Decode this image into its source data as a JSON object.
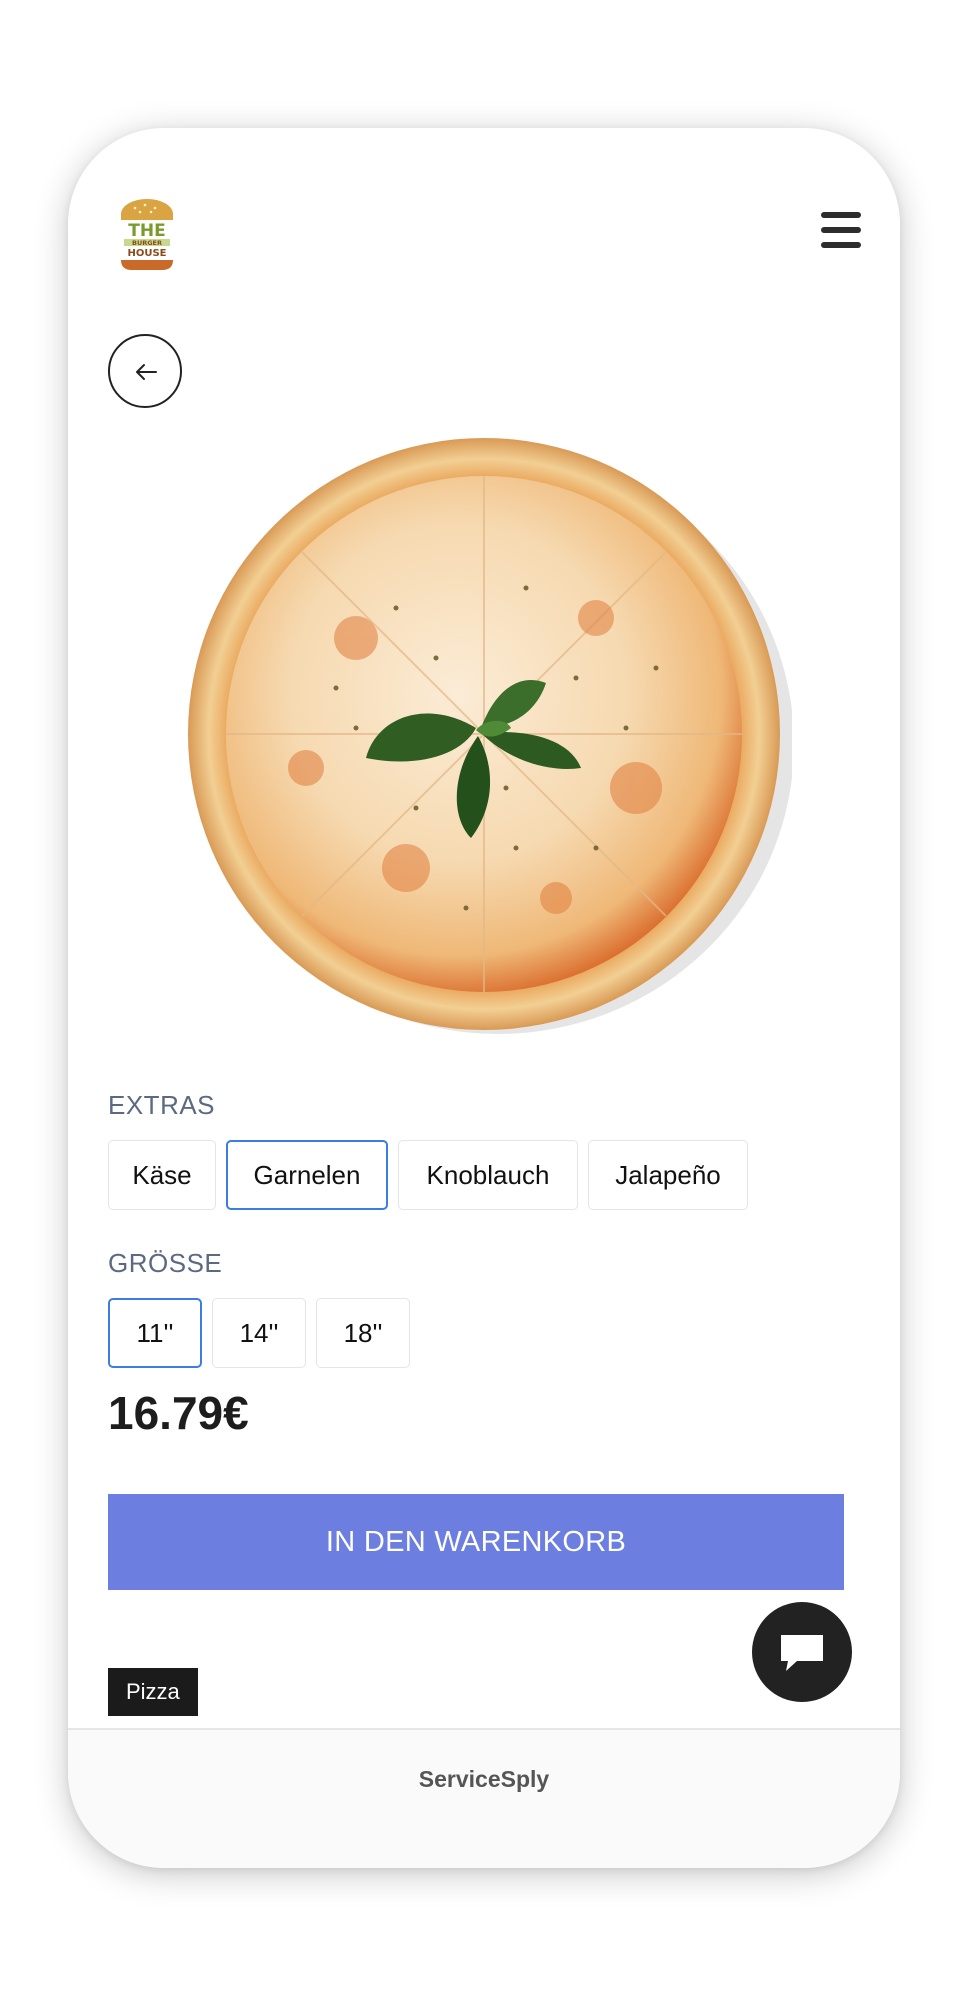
{
  "header": {
    "logo": {
      "line1": "THE",
      "line2": "BURGER",
      "line3": "HOUSE",
      "colors": {
        "bun": "#d9a441",
        "text_green": "#7a9a2e",
        "text_brown": "#8a4a1c"
      }
    },
    "menu_icon": "hamburger-menu-icon"
  },
  "navigation": {
    "back_icon": "arrow-left-icon"
  },
  "product": {
    "image": "pizza-margherita-image"
  },
  "extras": {
    "label": "EXTRAS",
    "options": [
      {
        "label": "Käse",
        "selected": false
      },
      {
        "label": "Garnelen",
        "selected": true
      },
      {
        "label": "Knoblauch",
        "selected": false
      },
      {
        "label": "Jalapeño",
        "selected": false
      }
    ]
  },
  "size": {
    "label": "GRÖSSE",
    "options": [
      {
        "label": "11''",
        "selected": true
      },
      {
        "label": "14''",
        "selected": false
      },
      {
        "label": "18''",
        "selected": false
      }
    ]
  },
  "price": "16.79€",
  "cart_button": {
    "label": "IN DEN WARENKORB",
    "color": "#6c7fe0"
  },
  "chat": {
    "icon": "chat-bubble-icon"
  },
  "category_tag": {
    "label": "Pizza"
  },
  "footer": {
    "brand": "ServiceSply"
  },
  "colors": {
    "selected_border": "#3d7de0",
    "label_text": "#5b6a82"
  }
}
